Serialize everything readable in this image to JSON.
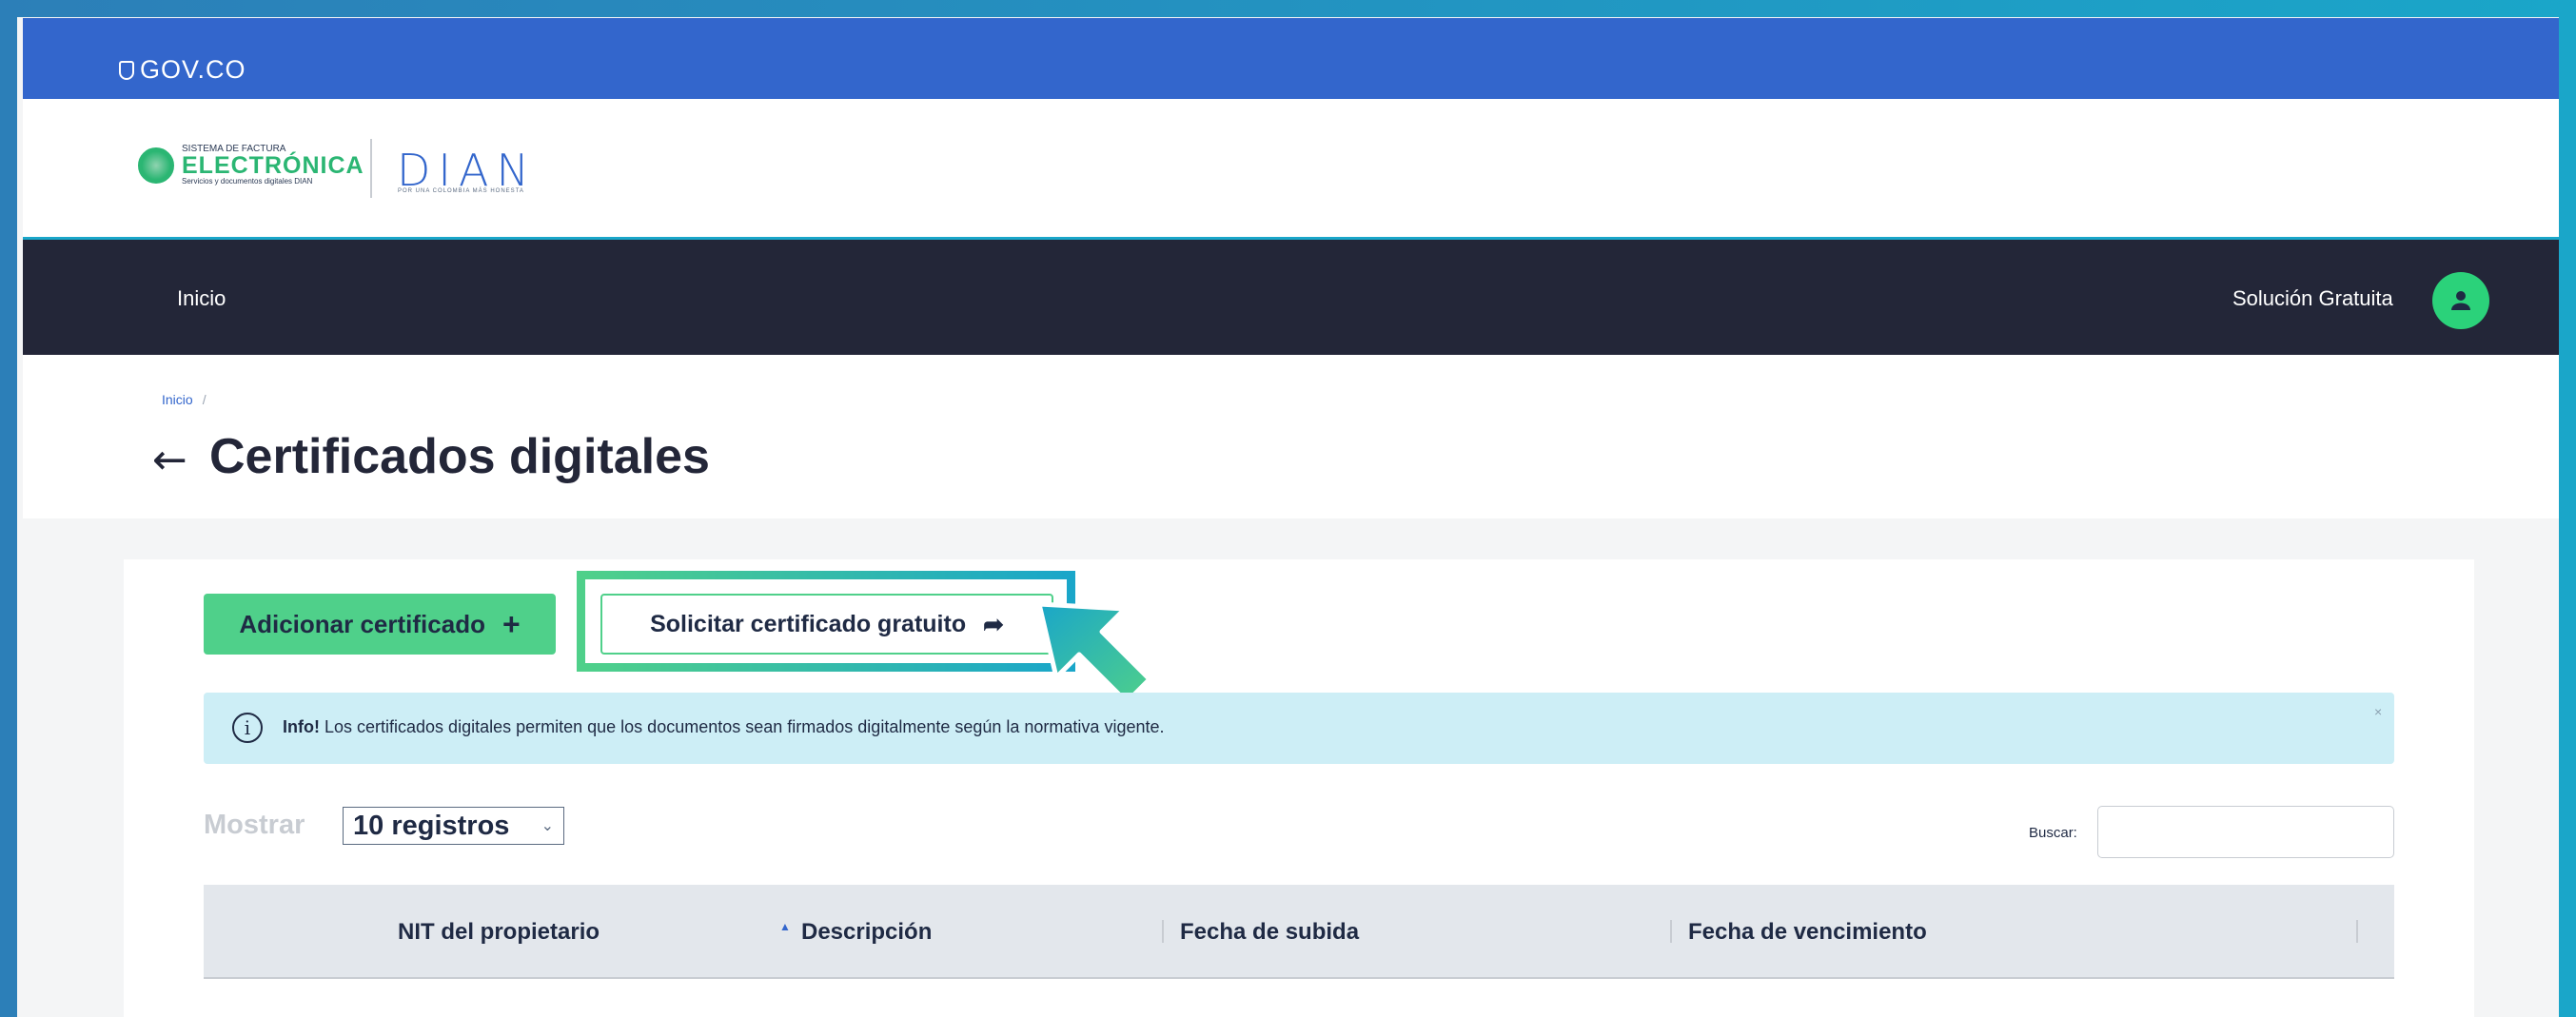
{
  "gov": {
    "label": "GOV.CO"
  },
  "brand": {
    "sfe_line1": "SISTEMA DE FACTURA",
    "sfe_line2": "ELECTRÓNICA",
    "sfe_line3": "Servicios y documentos digitales DIAN",
    "dian": "DIAN",
    "dian_sub": "POR UNA COLOMBIA MÁS HONESTA"
  },
  "nav": {
    "home": "Inicio",
    "solution": "Solución Gratuita",
    "avatar_icon": "user-icon"
  },
  "breadcrumb": {
    "home": "Inicio",
    "separator": "/"
  },
  "page": {
    "title": "Certificados digitales",
    "back_icon": "arrow-left-icon"
  },
  "actions": {
    "add_label": "Adicionar certificado",
    "add_icon": "plus-icon",
    "request_label": "Solicitar certificado gratuito",
    "request_icon": "share-icon"
  },
  "info": {
    "prefix": "Info!",
    "text": "Los certificados digitales permiten que los documentos sean firmados digitalmente según la normativa vigente.",
    "close": "×"
  },
  "table_controls": {
    "show_label": "Mostrar",
    "show_value": "10 registros",
    "search_label": "Buscar:",
    "search_value": ""
  },
  "table": {
    "columns": [
      "NIT del propietario",
      "Descripción",
      "Fecha de subida",
      "Fecha de vencimiento"
    ]
  },
  "colors": {
    "gov_blue": "#3366cc",
    "nav_dark": "#232638",
    "accent_green": "#4fd08a",
    "info_bg": "#cdeef6"
  }
}
